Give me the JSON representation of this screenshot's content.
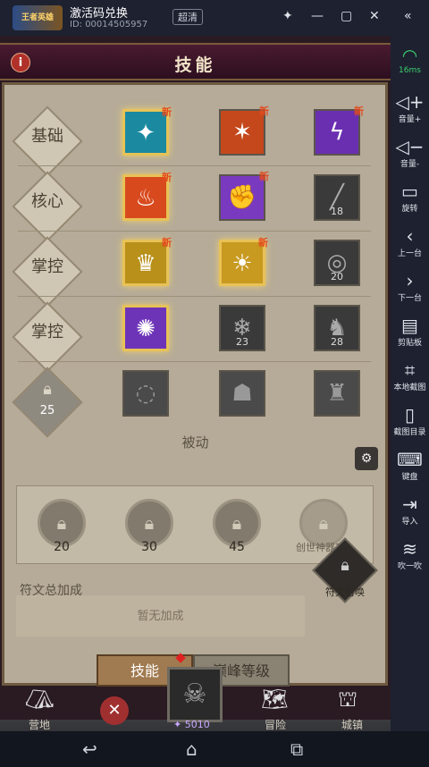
{
  "emulator": {
    "logo_text": "王者英雄",
    "window_title": "激活码兑换",
    "id_text": "ID: 00014505957",
    "quality_label": "超清",
    "side_items": [
      {
        "icon": "wifi-icon",
        "label": "16ms"
      },
      {
        "icon": "volume-up-icon",
        "label": "音量+"
      },
      {
        "icon": "volume-down-icon",
        "label": "音量-"
      },
      {
        "icon": "rotate-icon",
        "label": "旋转"
      },
      {
        "icon": "prev-icon",
        "label": "上一台"
      },
      {
        "icon": "next-icon",
        "label": "下一台"
      },
      {
        "icon": "clipboard-icon",
        "label": "剪贴板"
      },
      {
        "icon": "screenshot-icon",
        "label": "本地截图"
      },
      {
        "icon": "screenshot-dir-icon",
        "label": "截图目录"
      },
      {
        "icon": "keyboard-icon",
        "label": "键盘"
      },
      {
        "icon": "import-icon",
        "label": "导入"
      },
      {
        "icon": "blow-icon",
        "label": "吹一吹"
      }
    ]
  },
  "game": {
    "header_title": "技能",
    "rows": [
      {
        "label": "基础",
        "skills": [
          {
            "new": "新",
            "lock": ""
          },
          {
            "new": "新",
            "lock": ""
          },
          {
            "new": "新",
            "lock": ""
          }
        ]
      },
      {
        "label": "核心",
        "skills": [
          {
            "new": "新",
            "lock": ""
          },
          {
            "new": "新",
            "lock": ""
          },
          {
            "new": "",
            "lock": "18"
          }
        ]
      },
      {
        "label": "掌控",
        "skills": [
          {
            "new": "新",
            "lock": ""
          },
          {
            "new": "新",
            "lock": ""
          },
          {
            "new": "",
            "lock": "20"
          }
        ]
      },
      {
        "label": "掌控",
        "skills": [
          {
            "new": "",
            "lock": ""
          },
          {
            "new": "",
            "lock": "23"
          },
          {
            "new": "",
            "lock": "28"
          }
        ]
      },
      {
        "label": "25",
        "skills": [
          {
            "new": "",
            "lock": ""
          },
          {
            "new": "",
            "lock": ""
          },
          {
            "new": "",
            "lock": ""
          }
        ]
      }
    ],
    "passive_label": "被动",
    "passive_slots": [
      "20",
      "30",
      "45",
      "创世神器2阶"
    ],
    "rune_title": "符文总加成",
    "rune_empty": "暂无加成",
    "rune_summon": "符文召唤",
    "tabs": {
      "skills": "技能",
      "peak": "巅峰等级"
    },
    "currency": "5010",
    "bottom_nav": [
      "营地",
      "",
      "冒险",
      "城镇"
    ]
  }
}
